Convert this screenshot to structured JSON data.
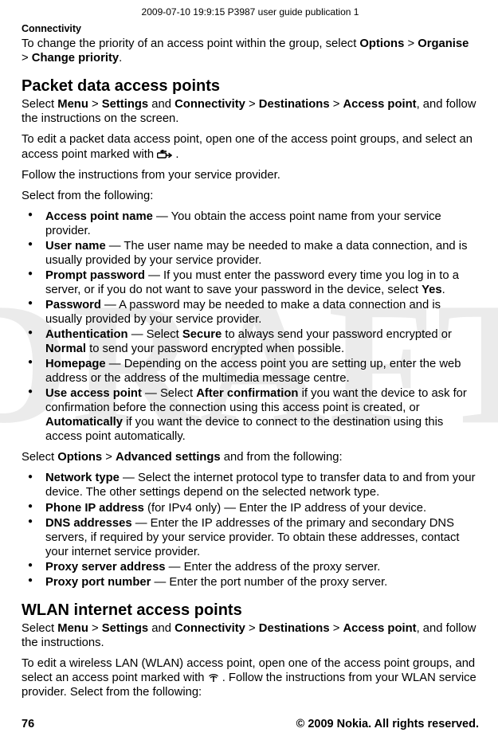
{
  "watermark": "DRAFT",
  "header": {
    "meta": "2009-07-10 19:9:15 P3987 user guide publication 1",
    "section": "Connectivity"
  },
  "intro": {
    "priority": {
      "pre": "To change the priority of an access point within the group, select ",
      "options": "Options",
      "gt1": " > ",
      "organise": "Organise",
      "gt2": " > ",
      "change": "Change priority",
      "period": "."
    }
  },
  "packet": {
    "heading": "Packet data access points",
    "path": {
      "pre": "Select ",
      "menu": "Menu",
      "gt1": " > ",
      "settings": "Settings",
      "and": " and ",
      "connectivity": "Connectivity",
      "gt2": " > ",
      "destinations": "Destinations",
      "gt3": " > ",
      "accesspoint": "Access point",
      "tail": ", and follow the instructions on the screen."
    },
    "edit": {
      "text": "To edit a packet data access point, open one of the access point groups, and select an access point marked with ",
      "period": "."
    },
    "follow": "Follow the instructions from your service provider.",
    "select": "Select from the following:",
    "items": [
      {
        "term": "Access point name",
        "desc": " — You obtain the access point name from your service provider."
      },
      {
        "term": "User name",
        "desc": " — The user name may be needed to make a data connection, and is usually provided by your service provider."
      },
      {
        "term": "Prompt password",
        "desc_a": " — If you must enter the password every time you log in to a server, or if you do not want to save your password in the device, select",
        "bold_a": "Yes",
        "desc_b": "."
      },
      {
        "term": "Password",
        "desc": " — A password may be needed to make a data connection and is usually provided by your service provider."
      },
      {
        "term": "Authentication",
        "desc_a": " — Select",
        "bold_a": "Secure",
        "desc_b": "to always send your password encrypted or",
        "bold_b": "Normal",
        "desc_c": "to send your password encrypted when possible."
      },
      {
        "term": "Homepage",
        "desc": " — Depending on the access point you are setting up, enter the web address or the address of the multimedia message centre."
      },
      {
        "term": "Use access point",
        "desc_a": " — Select",
        "bold_a": "After confirmation",
        "desc_b": "if you want the device to ask for confirmation before the connection using this access point is created, or",
        "bold_b": "Automatically",
        "desc_c": "if you want the device to connect to the destination using this access point automatically."
      }
    ],
    "advanced": {
      "pre": "Select ",
      "options": "Options",
      "gt": " > ",
      "advset": "Advanced settings",
      "tail": " and from the following:"
    },
    "adv_items": [
      {
        "term": "Network type",
        "desc": " — Select the internet protocol type to transfer data to and from your device. The other settings depend on the selected network type."
      },
      {
        "term": "Phone IP address",
        "desc": "(for IPv4 only) — Enter the IP address of your device."
      },
      {
        "term": "DNS addresses",
        "desc": " — Enter the IP addresses of the primary and secondary DNS servers, if required by your service provider. To obtain these addresses, contact your internet service provider."
      },
      {
        "term": "Proxy server address",
        "desc": " — Enter the address of the proxy server."
      },
      {
        "term": "Proxy port number",
        "desc": " — Enter the port number of the proxy server."
      }
    ]
  },
  "wlan": {
    "heading": "WLAN internet access points",
    "path": {
      "pre": "Select ",
      "menu": "Menu",
      "gt1": " > ",
      "settings": "Settings",
      "and": " and ",
      "connectivity": "Connectivity",
      "gt2": " > ",
      "destinations": "Destinations",
      "gt3": " > ",
      "accesspoint": "Access point",
      "tail": ", and follow the instructions."
    },
    "edit": {
      "text_a": "To edit a wireless LAN (WLAN) access point, open one of the access point groups, and select an access point marked with ",
      "text_b": ". Follow the instructions from your WLAN service provider. Select from the following:"
    }
  },
  "footer": {
    "page": "76",
    "copyright": "© 2009 Nokia. All rights reserved."
  }
}
